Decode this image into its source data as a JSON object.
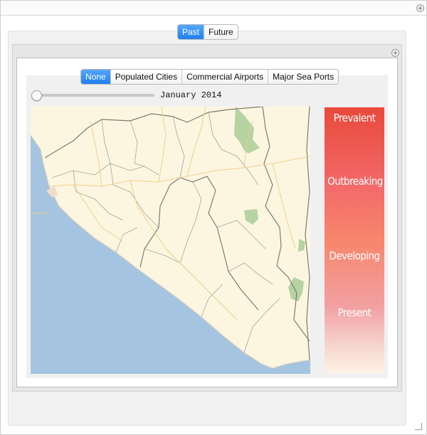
{
  "mode_tabs": [
    {
      "label": "Past",
      "active": true
    },
    {
      "label": "Future",
      "active": false
    }
  ],
  "layer_tabs": [
    {
      "label": "None",
      "active": true
    },
    {
      "label": "Populated Cities",
      "active": false
    },
    {
      "label": "Commercial Airports",
      "active": false
    },
    {
      "label": "Major Sea Ports",
      "active": false
    }
  ],
  "timeline": {
    "date_label": "January 2014",
    "slider_fraction": 0.0
  },
  "legend": {
    "labels": [
      "Prevalent",
      "Outbreaking",
      "Developing",
      "Present"
    ]
  },
  "colors": {
    "accent": "#2b88f5",
    "ocean": "#a4c4e1",
    "land": "#fcf6e1",
    "park": "#b6d3a2",
    "prevalent": "#e8493b",
    "outbreaking": "#f36a6a",
    "developing": "#f7866c",
    "present": "#f2a0a2"
  },
  "icons": {
    "window_plus": "plus-circle-icon",
    "panel_plus": "plus-circle-icon",
    "resize": "resize-grip-icon"
  }
}
